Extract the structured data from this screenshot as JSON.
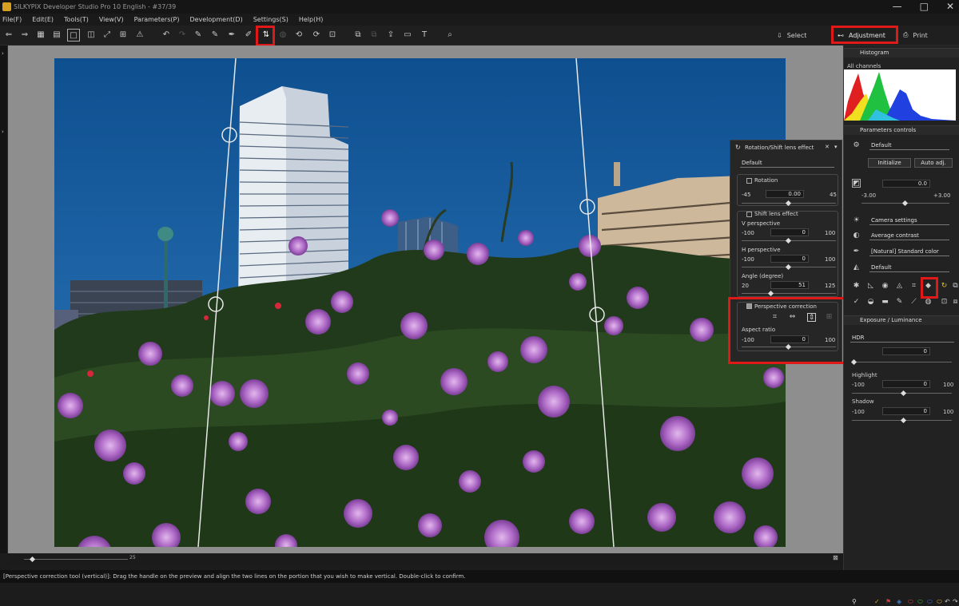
{
  "window": {
    "title": "SILKYPIX Developer Studio Pro 10 English - #37/39",
    "controls": [
      "—",
      "□",
      "✕"
    ]
  },
  "menu": [
    "File(F)",
    "Edit(E)",
    "Tools(T)",
    "View(V)",
    "Parameters(P)",
    "Development(D)",
    "Settings(S)",
    "Help(H)"
  ],
  "modes": {
    "select": "Select",
    "adjustment": "Adjustment",
    "print": "Print"
  },
  "status_bar": "[Perspective correction tool (vertical)]: Drag the handle on the preview and align the two lines on the portion that you wish to make vertical. Double-click to confirm.",
  "zoom_readout": "25",
  "floating_panel": {
    "title": "Rotation/Shift lens effect",
    "preset": "Default",
    "rotation": {
      "label": "Rotation",
      "min": "-45",
      "value": "0.00",
      "max": "45"
    },
    "shift_label": "Shift lens effect",
    "v_perspective": {
      "label": "V perspective",
      "min": "-100",
      "value": "0",
      "max": "100"
    },
    "h_perspective": {
      "label": "H perspective",
      "min": "-100",
      "value": "0",
      "max": "100"
    },
    "angle": {
      "label": "Angle (degree)",
      "min": "20",
      "value": "51",
      "max": "125"
    },
    "perspective_label": "Perspective correction",
    "aspect": {
      "label": "Aspect ratio",
      "min": "-100",
      "value": "0",
      "max": "100"
    }
  },
  "right_panel": {
    "histogram_title": "Histogram",
    "histogram_channel": "All channels",
    "params_title": "Parameters controls",
    "taste": "Default",
    "initialize": "Initialize",
    "auto_adj": "Auto adj.",
    "exposure_value": "0.0",
    "exposure_min": "-3.00",
    "exposure_max": "+3.00",
    "white_balance": "Camera settings",
    "tone": "Average contrast",
    "color": "[Natural] Standard color",
    "sharpness": "Default",
    "exposure_title": "Exposure / Luminance",
    "hdr_mode": "HDR",
    "hdr_value": "0",
    "highlight": {
      "label": "Highlight",
      "min": "-100",
      "value": "0",
      "max": "100"
    },
    "shadow": {
      "label": "Shadow",
      "min": "-100",
      "value": "0",
      "max": "100"
    }
  }
}
